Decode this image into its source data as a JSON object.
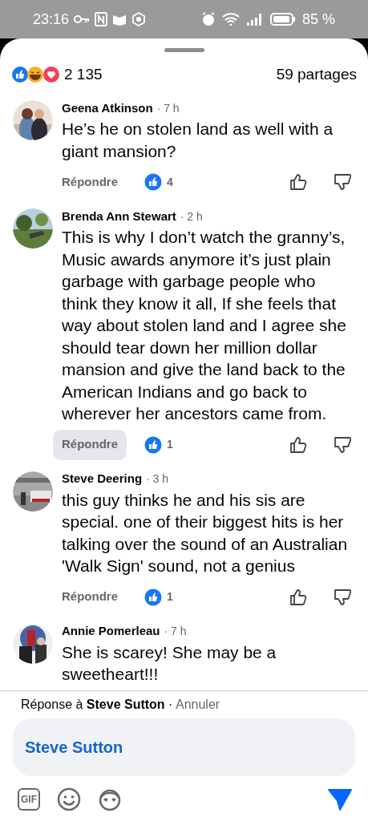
{
  "status_bar": {
    "time": "23:16",
    "battery": "85 %"
  },
  "reactions": {
    "count": "2 135",
    "shares": "59 partages"
  },
  "comments": [
    {
      "author": "Geena Atkinson",
      "time": "· 7 h",
      "text": "He’s he on stolen land as well with a giant mansion?",
      "reply": "Répondre",
      "reply_highlighted": false,
      "likes": "4"
    },
    {
      "author": "Brenda Ann Stewart",
      "time": "· 2 h",
      "text": "This is why I don’t watch the granny’s, Music awards anymore it’s just plain garbage with garbage people who think they know it all, If she feels that way about stolen land and I agree she should tear down her million dollar mansion and give the land back to the American Indians and go back to wherever her ancestors came from.",
      "reply": "Répondre",
      "reply_highlighted": true,
      "likes": "1"
    },
    {
      "author": "Steve Deering",
      "time": "· 3 h",
      "text": "this guy thinks he and his sis are special. one of their biggest hits is her talking over the sound of an Australian 'Walk Sign' sound, not a genius",
      "reply": "Répondre",
      "reply_highlighted": false,
      "likes": "1"
    },
    {
      "author": "Annie Pomerleau",
      "time": "· 7 h",
      "text": "She is scarey!  She may be a sweetheart!!!"
    }
  ],
  "reply_bar": {
    "prefix": "Réponse à",
    "name": "Steve Sutton",
    "separator": "·",
    "cancel": "Annuler"
  },
  "composer": {
    "value": "Steve Sutton"
  },
  "toolbar": {
    "gif": "GIF"
  }
}
